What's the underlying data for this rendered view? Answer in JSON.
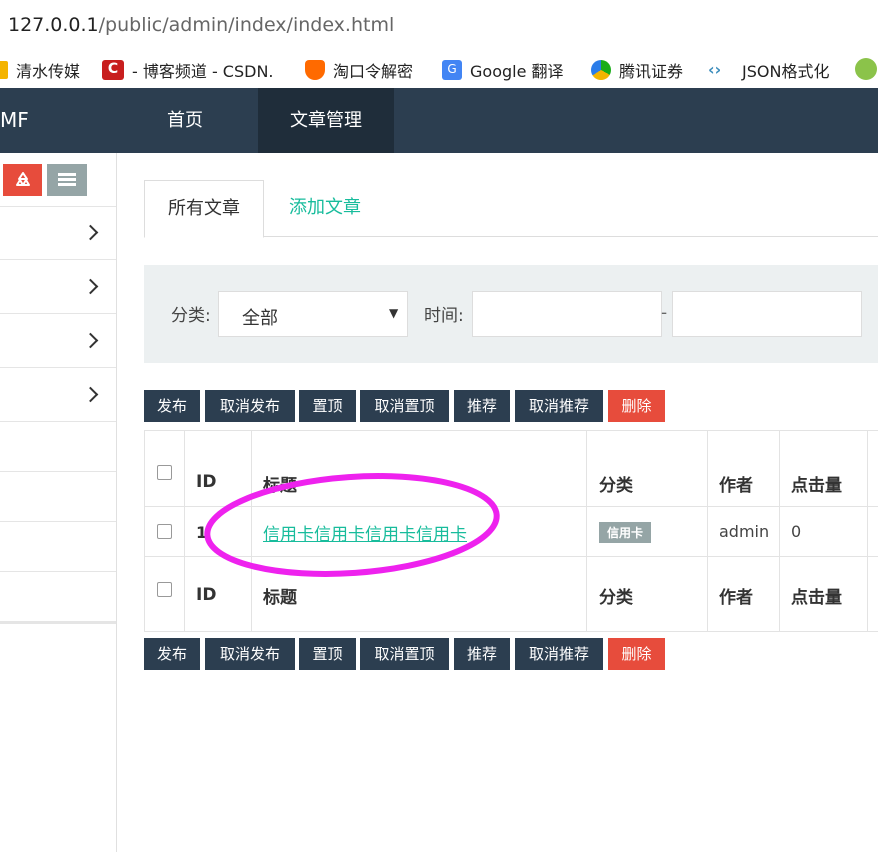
{
  "browser": {
    "url_host": "127.0.0.1",
    "url_path": "/public/admin/index/index.html",
    "bookmarks": [
      {
        "label": "清水传媒",
        "icon": "folder-icon",
        "color": "#f4b400"
      },
      {
        "label": "- 博客频道 - CSDN.",
        "icon": "csdn-icon",
        "color": "#c81e1e"
      },
      {
        "label": "淘口令解密",
        "icon": "shield-icon",
        "color": "#ff6a00"
      },
      {
        "label": "Google 翻译",
        "icon": "google-translate-icon",
        "color": "#4285f4"
      },
      {
        "label": "腾讯证券",
        "icon": "tencent-icon",
        "color": "#1aad19"
      },
      {
        "label": "JSON格式化",
        "icon": "json-icon",
        "color": "#3c8dbc"
      }
    ]
  },
  "topnav": {
    "brand": "MF",
    "items": [
      {
        "label": "首页"
      },
      {
        "label": "文章管理"
      }
    ]
  },
  "sidebar": {
    "buttons": [
      {
        "icon": "recycle-icon",
        "color": "#e74c3c"
      },
      {
        "icon": "list-icon",
        "color": "#95a5a6"
      }
    ]
  },
  "tabs": [
    {
      "label": "所有文章",
      "active": true
    },
    {
      "label": "添加文章",
      "active": false
    }
  ],
  "filter": {
    "category_label": "分类:",
    "category_value": "全部",
    "time_label": "时间:",
    "separator": "-"
  },
  "actions": [
    "发布",
    "取消发布",
    "置顶",
    "取消置顶",
    "推荐",
    "取消推荐",
    "删除"
  ],
  "table": {
    "headers": [
      "ID",
      "标题",
      "分类",
      "作者",
      "点击量"
    ],
    "rows": [
      {
        "id": "1",
        "title": "信用卡信用卡信用卡信用卡",
        "category": "信用卡",
        "author": "admin",
        "clicks": "0"
      }
    ]
  },
  "colors": {
    "nav_bg": "#2c3e50",
    "nav_active": "#1f2d3a",
    "accent_green": "#18bc9c",
    "danger": "#e74c3c",
    "annotation": "#ee22ee"
  }
}
